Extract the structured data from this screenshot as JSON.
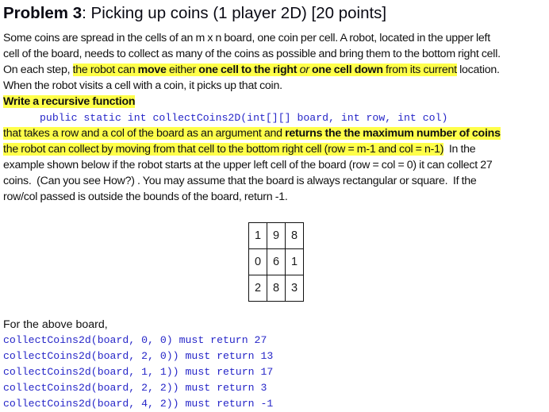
{
  "title": {
    "bold": "Problem 3",
    "rest": ": Picking up coins (1 player 2D) [20 points]"
  },
  "description": {
    "l1": "Some coins are spread in the cells of an m x n board, one coin per cell. A robot, located in the upper left",
    "l2": "cell of the board, needs to collect as many of the coins as possible and bring them to the bottom right cell.",
    "l3a": "On each step, ",
    "l3b": "the robot can ",
    "l3c": "move",
    "l3d": " either ",
    "l3e": "one cell to the right",
    "l3f": " or ",
    "l3g": "one cell down",
    "l3h": " from its current",
    "l3i": " location.",
    "l4": "When the robot visits a cell with a coin, it picks up that coin.",
    "l5": "Write a recursive function",
    "signature": "public static int collectCoins2D(int[][] board, int row, int col)",
    "l7a": "that takes a row and a col of the board as an argument and ",
    "l7b": "returns the the maximum number of coins",
    "l8a": "the robot can collect by moving from that cell to the bottom right cell (row = m-1 and col = n-1)",
    "l8b": "  In the",
    "l9": "example shown below if the robot starts at the upper left cell of the board (row = col = 0) it can collect 27",
    "l10": "coins.  (Can you see How?) . You may assume that the board is always rectangular or square.  If the",
    "l11": "row/col passed is outside the bounds of the board, return -1."
  },
  "board": [
    [
      "1",
      "9",
      "8"
    ],
    [
      "0",
      "6",
      "1"
    ],
    [
      "2",
      "8",
      "3"
    ]
  ],
  "examples": {
    "intro": "For the above board,",
    "calls": [
      "collectCoins2d(board, 0, 0) must return 27",
      "collectCoins2d(board, 2, 0)) must return 13",
      "collectCoins2d(board, 1, 1)) must return 17",
      "collectCoins2d(board, 2, 2)) must return 3",
      "collectCoins2d(board, 4, 2)) must return -1"
    ]
  },
  "colors": {
    "highlight": "#ffff4a",
    "code": "#2626c8",
    "text": "#111111"
  }
}
